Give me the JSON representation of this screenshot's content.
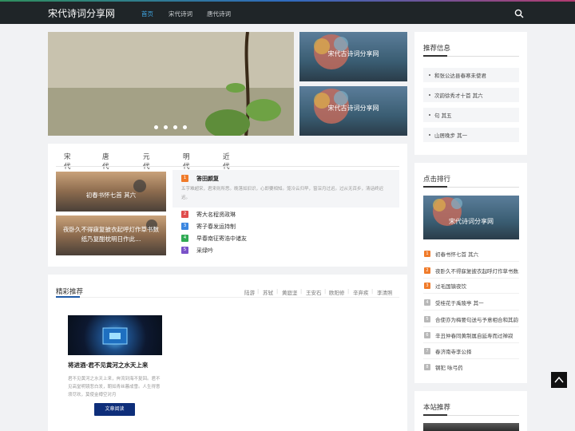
{
  "header": {
    "brand": "宋代诗词分享网",
    "nav": [
      {
        "label": "首页",
        "active": true
      },
      {
        "label": "宋代诗词",
        "active": false
      },
      {
        "label": "唐代诗词",
        "active": false
      }
    ],
    "search_icon": "search-icon"
  },
  "slider": {
    "dots": 4,
    "side_thumbs": [
      {
        "label": "宋代古诗词分享网"
      },
      {
        "label": "宋代古诗词分享网"
      }
    ]
  },
  "tabs": [
    {
      "label": "宋代诗词",
      "active": true
    },
    {
      "label": "唐代诗词",
      "active": false
    },
    {
      "label": "元代诗词",
      "active": false
    },
    {
      "label": "明代诗词",
      "active": false
    },
    {
      "label": "近代诗词",
      "active": false
    }
  ],
  "poem_cards": [
    {
      "caption": "初春书怀七首 其六"
    },
    {
      "caption": "夜卧久不得寐复披衣起呼灯作草书数纸乃复酣枕明日作此..."
    }
  ],
  "hot_list": {
    "top": {
      "num": "1",
      "title": "答田颜复",
      "desc": "五字难超宋，君来则所思。晚落如旧识，心即要相知。笼冷云归早，窗深月过迟。过从无百步，清话终迟迟。"
    },
    "items": [
      {
        "num": "2",
        "title": "寄大名程贤政琳",
        "color": "#e04c4c"
      },
      {
        "num": "3",
        "title": "寄子春发运持制",
        "color": "#3a86e0"
      },
      {
        "num": "4",
        "title": "早春南征寄浩中诸友",
        "color": "#2faa53"
      },
      {
        "num": "5",
        "title": "采绿吟",
        "color": "#7a52c8"
      }
    ]
  },
  "featured": {
    "title": "精彩推荐",
    "links": [
      "陆游",
      "苏轼",
      "黄庭坚",
      "王安石",
      "欧阳修",
      "辛弃疾",
      "李清照"
    ],
    "article": {
      "title": "将进酒·君不见黄河之水天上来",
      "desc": "君不见黄河之水天上来，奔流到海不复回。君不见高堂明镜悲白发，朝如青丝暮成雪。人生得意须尽欢，莫使金樽空对月",
      "button": "文章阅读"
    }
  },
  "sidebar": {
    "recommend": {
      "title": "推荐信息",
      "items": [
        "和张公达县春寒未使君",
        "次韵徐秀才十首 其六",
        "句 其五",
        "山居晚步 其一"
      ]
    },
    "ranking": {
      "title": "点击排行",
      "image_label": "宋代诗词分享网",
      "items": [
        {
          "num": "1",
          "title": "初春书怀七首 其六",
          "color": "#f07b2a"
        },
        {
          "num": "2",
          "title": "夜卧久不得寐复披衣起呼灯作草书数...",
          "color": "#f07b2a"
        },
        {
          "num": "3",
          "title": "过毛国镇夜饮",
          "color": "#f07b2a"
        },
        {
          "num": "4",
          "title": "受桂花于禹陵亭 其一",
          "color": "#b8b8b8"
        },
        {
          "num": "5",
          "title": "合使亦为梅要句送与予意相合和其韵",
          "color": "#b8b8b8"
        },
        {
          "num": "6",
          "title": "辛丑仲春同黄制属自延寿而过禅寂",
          "color": "#b8b8b8"
        },
        {
          "num": "7",
          "title": "春济南寺李公择",
          "color": "#b8b8b8"
        },
        {
          "num": "8",
          "title": "钢犯 咏弓药",
          "color": "#b8b8b8"
        }
      ]
    },
    "site_recommend": {
      "title": "本站推荐"
    }
  },
  "back_to_top_icon": "chevron-up-icon"
}
